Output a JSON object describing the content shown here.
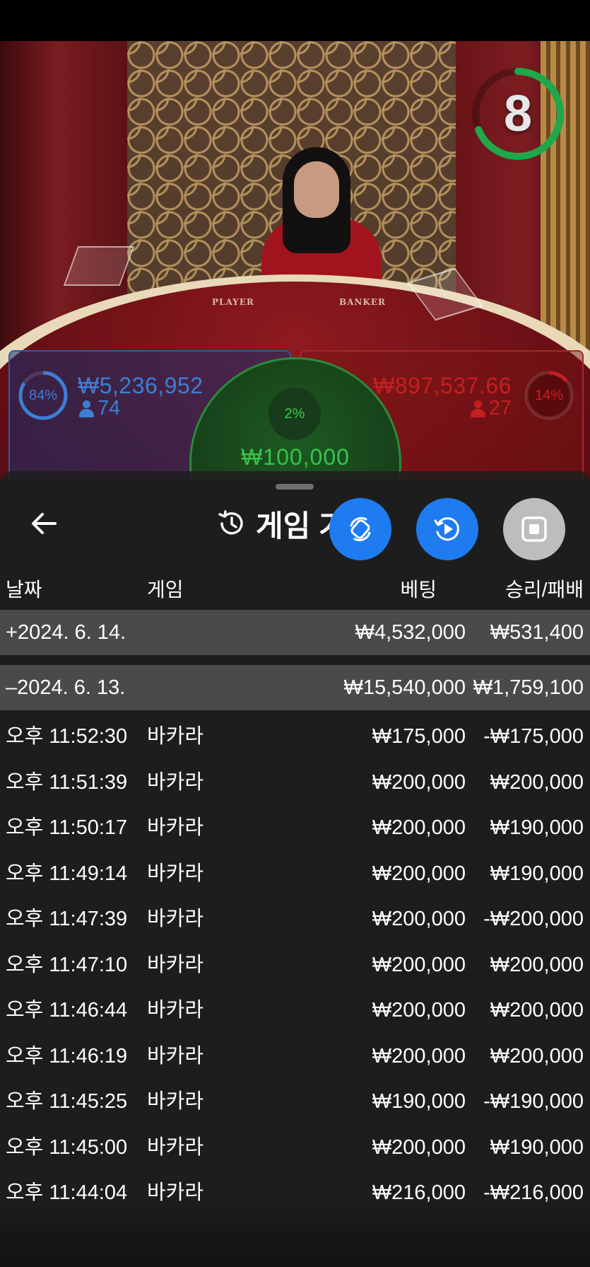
{
  "video": {
    "timer": "8",
    "table_labels": {
      "player": "PLAYER",
      "banker": "BANKER"
    }
  },
  "bets": {
    "player": {
      "percent": "84%",
      "amount": "₩5,236,952",
      "players": "74"
    },
    "tie": {
      "percent": "2%",
      "amount": "₩100,000"
    },
    "banker": {
      "percent": "14%",
      "amount": "₩897,537.66",
      "players": "27"
    }
  },
  "history": {
    "title": "게임 기록",
    "columns": {
      "date": "날짜",
      "game": "게임",
      "bet": "베팅",
      "result": "승리/패배"
    },
    "date_groups": [
      {
        "toggle": "+",
        "date": "2024. 6. 14.",
        "bet": "₩4,532,000",
        "result": "₩531,400"
      },
      {
        "toggle": "–",
        "date": "2024. 6. 13.",
        "bet": "₩15,540,000",
        "result": "₩1,759,100"
      }
    ],
    "rows": [
      {
        "time": "오후 11:52:30",
        "game": "바카라",
        "bet": "₩175,000",
        "result": "-₩175,000"
      },
      {
        "time": "오후 11:51:39",
        "game": "바카라",
        "bet": "₩200,000",
        "result": "₩200,000"
      },
      {
        "time": "오후 11:50:17",
        "game": "바카라",
        "bet": "₩200,000",
        "result": "₩190,000"
      },
      {
        "time": "오후 11:49:14",
        "game": "바카라",
        "bet": "₩200,000",
        "result": "₩190,000"
      },
      {
        "time": "오후 11:47:39",
        "game": "바카라",
        "bet": "₩200,000",
        "result": "-₩200,000"
      },
      {
        "time": "오후 11:47:10",
        "game": "바카라",
        "bet": "₩200,000",
        "result": "₩200,000"
      },
      {
        "time": "오후 11:46:44",
        "game": "바카라",
        "bet": "₩200,000",
        "result": "₩200,000"
      },
      {
        "time": "오후 11:46:19",
        "game": "바카라",
        "bet": "₩200,000",
        "result": "₩200,000"
      },
      {
        "time": "오후 11:45:25",
        "game": "바카라",
        "bet": "₩190,000",
        "result": "-₩190,000"
      },
      {
        "time": "오후 11:45:00",
        "game": "바카라",
        "bet": "₩200,000",
        "result": "₩190,000"
      },
      {
        "time": "오후 11:44:04",
        "game": "바카라",
        "bet": "₩216,000",
        "result": "-₩216,000"
      }
    ]
  },
  "colors": {
    "player_blue": "#3b7fd4",
    "banker_red": "#c42020",
    "tie_green": "#37c34a",
    "button_blue": "#1e7cf0",
    "timer_green": "#1fa84a"
  }
}
